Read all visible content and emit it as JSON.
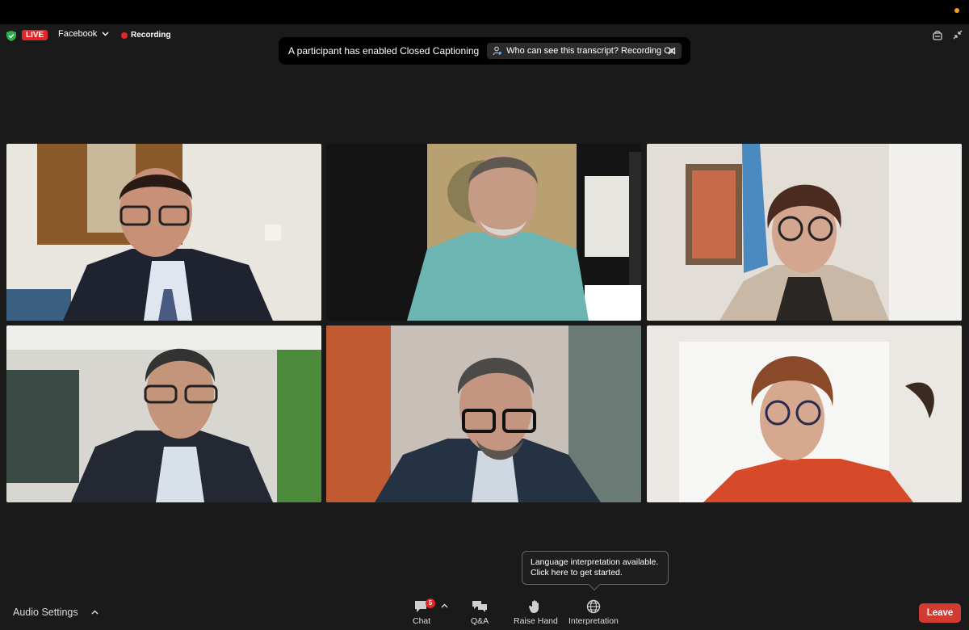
{
  "topbar": {
    "live_label": "LIVE",
    "stream_platform": "Facebook",
    "recording_label": "Recording"
  },
  "caption_banner": {
    "message": "A participant has enabled Closed Captioning",
    "transcript_link": "Who can see this transcript? Recording On"
  },
  "tooltip": {
    "line1": "Language interpretation available.",
    "line2": "Click here to get started."
  },
  "toolbar": {
    "audio_settings": "Audio Settings",
    "chat_label": "Chat",
    "chat_badge": "5",
    "qa_label": "Q&A",
    "raise_hand_label": "Raise Hand",
    "interpretation_label": "Interpretation",
    "leave_label": "Leave"
  },
  "colors": {
    "live": "#e02828",
    "active_speaker_border": "#5ec85e",
    "leave": "#d13b32"
  }
}
